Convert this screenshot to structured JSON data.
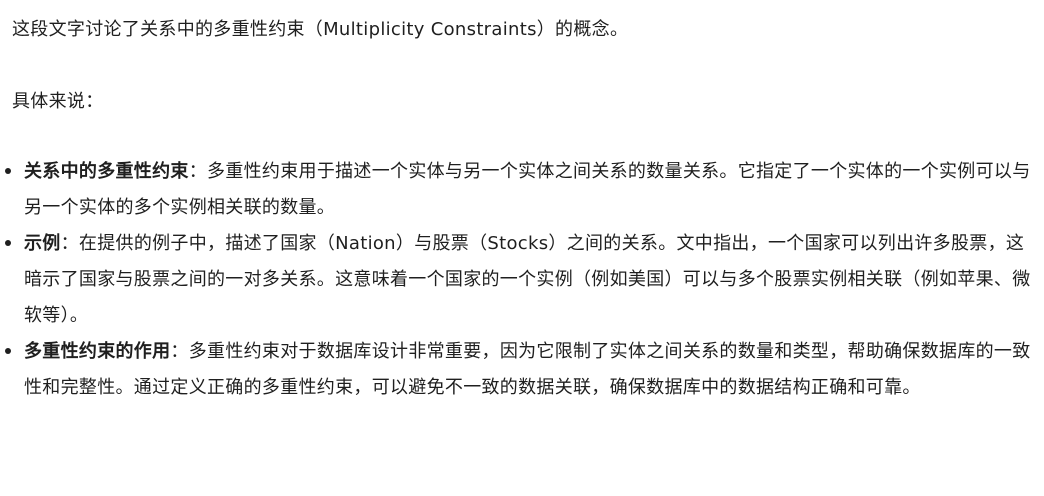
{
  "intro": "这段文字讨论了关系中的多重性约束（Multiplicity Constraints）的概念。",
  "lead": "具体来说：",
  "bullets": [
    {
      "term": "关系中的多重性约束",
      "sep": "：",
      "text": "多重性约束用于描述一个实体与另一个实体之间关系的数量关系。它指定了一个实体的一个实例可以与另一个实体的多个实例相关联的数量。"
    },
    {
      "term": "示例",
      "sep": "：",
      "text": "在提供的例子中，描述了国家（Nation）与股票（Stocks）之间的关系。文中指出，一个国家可以列出许多股票，这暗示了国家与股票之间的一对多关系。这意味着一个国家的一个实例（例如美国）可以与多个股票实例相关联（例如苹果、微软等）。"
    },
    {
      "term": "多重性约束的作用",
      "sep": "：",
      "text": "多重性约束对于数据库设计非常重要，因为它限制了实体之间关系的数量和类型，帮助确保数据库的一致性和完整性。通过定义正确的多重性约束，可以避免不一致的数据关联，确保数据库中的数据结构正确和可靠。"
    }
  ]
}
